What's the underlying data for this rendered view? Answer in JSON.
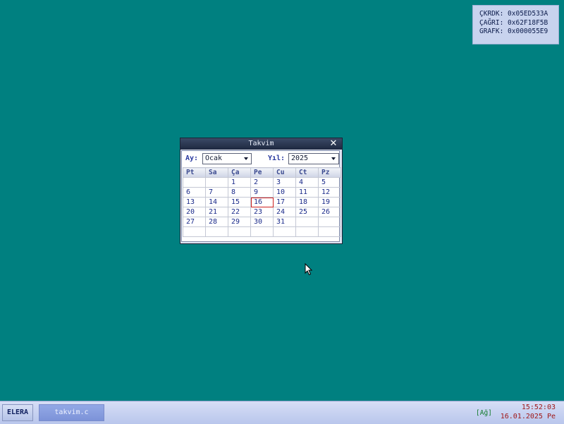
{
  "debug": {
    "rows": [
      "ÇKRDK: 0x05ED533A",
      "ÇAĞRI: 0x62F18F5B",
      "GRAFK: 0x000055E9"
    ]
  },
  "window": {
    "title": "Takvim",
    "close_icon": "close-icon",
    "month_label": "Ay:",
    "month_value": "Ocak",
    "year_label": "Yıl:",
    "year_value": "2025"
  },
  "calendar": {
    "weekdays": [
      "Pt",
      "Sa",
      "Ça",
      "Pe",
      "Cu",
      "Ct",
      "Pz"
    ],
    "weeks": [
      [
        "",
        "",
        "1",
        "2",
        "3",
        "4",
        "5"
      ],
      [
        "6",
        "7",
        "8",
        "9",
        "10",
        "11",
        "12"
      ],
      [
        "13",
        "14",
        "15",
        "16",
        "17",
        "18",
        "19"
      ],
      [
        "20",
        "21",
        "22",
        "23",
        "24",
        "25",
        "26"
      ],
      [
        "27",
        "28",
        "29",
        "30",
        "31",
        "",
        ""
      ],
      [
        "",
        "",
        "",
        "",
        "",
        "",
        ""
      ]
    ],
    "today": "16",
    "today_color": "#cc2020"
  },
  "taskbar": {
    "start_label": "ELERA",
    "task_label": "takvim.c",
    "network": "[Ağ]",
    "time": "15:52:03",
    "date": "16.01.2025 Pe"
  }
}
